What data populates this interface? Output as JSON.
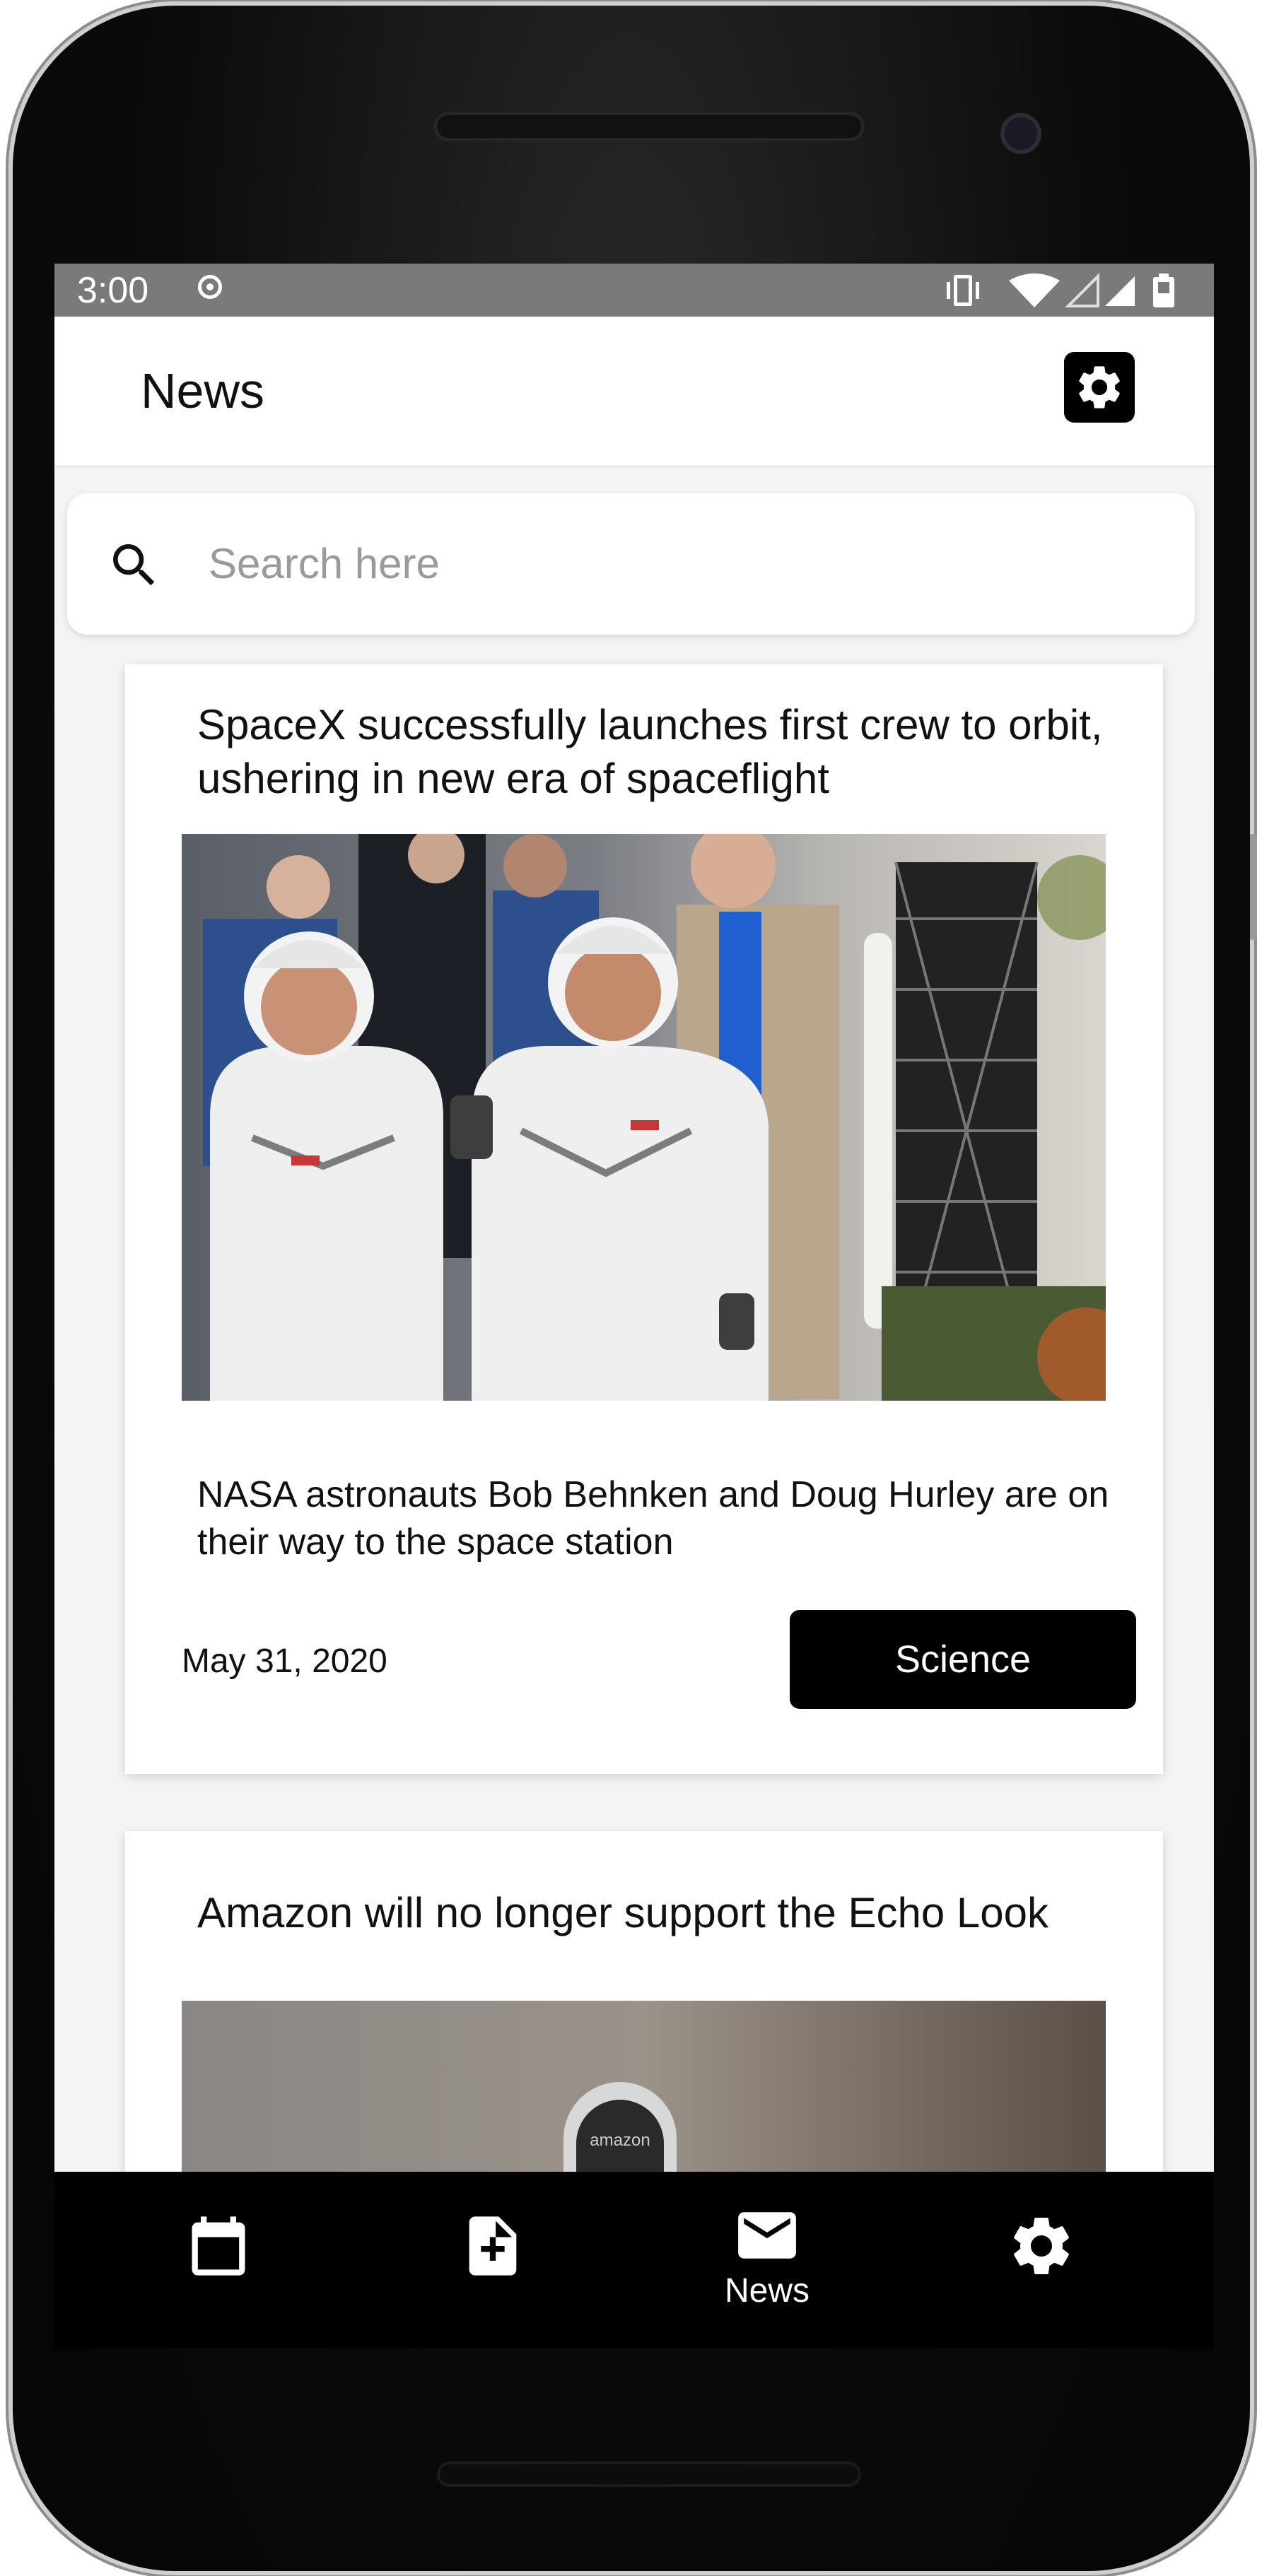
{
  "status_bar": {
    "time": "3:00"
  },
  "app_bar": {
    "title": "News",
    "settings_icon": "gear-icon"
  },
  "search": {
    "placeholder": "Search here",
    "value": "",
    "icon": "search-icon"
  },
  "articles": [
    {
      "title": "SpaceX successfully launches first crew to orbit, ushering in new era of spaceflight",
      "summary": "NASA astronauts Bob Behnken and Doug Hurley are on their way to the space station",
      "date": "May 31, 2020",
      "category": "Science"
    },
    {
      "title": "Amazon will no longer support the Echo Look",
      "image_text": "amazon"
    }
  ],
  "bottom_nav": [
    {
      "icon": "calendar-icon",
      "label": ""
    },
    {
      "icon": "note-add-icon",
      "label": ""
    },
    {
      "icon": "mail-icon",
      "label": "News"
    },
    {
      "icon": "gear-icon",
      "label": ""
    }
  ],
  "colors": {
    "accent": "#000000",
    "status_bar": "#7a7a7a",
    "screen_bg": "#f4f4f4",
    "placeholder": "#9a9a9a"
  }
}
